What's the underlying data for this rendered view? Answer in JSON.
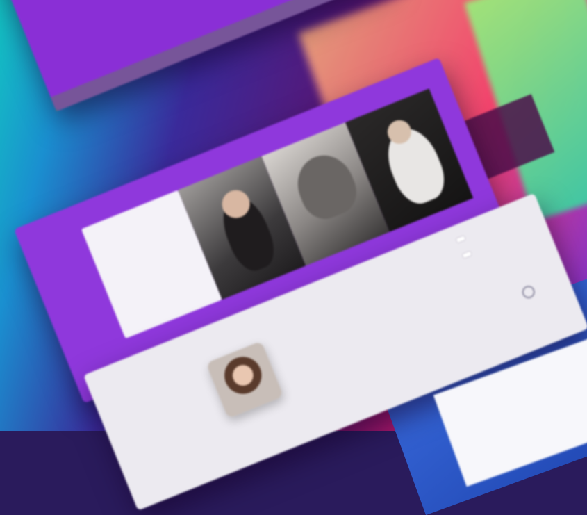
{
  "colors": {
    "top_card": "#8a2fd6",
    "mid_card": "#8f38dc",
    "bottom_card": "#eceaf0",
    "accent_pink": "#c01868",
    "accent_teal": "#13c2c2"
  },
  "top_card": {
    "body_text": ""
  },
  "mid_card": {
    "nav": [
      "",
      ""
    ],
    "panel_caption": ""
  },
  "bottom_card": {
    "quote": "",
    "buttons": [
      "",
      ""
    ]
  },
  "icons": {
    "avatar": "person-avatar-icon",
    "settings": "circle-icon"
  }
}
